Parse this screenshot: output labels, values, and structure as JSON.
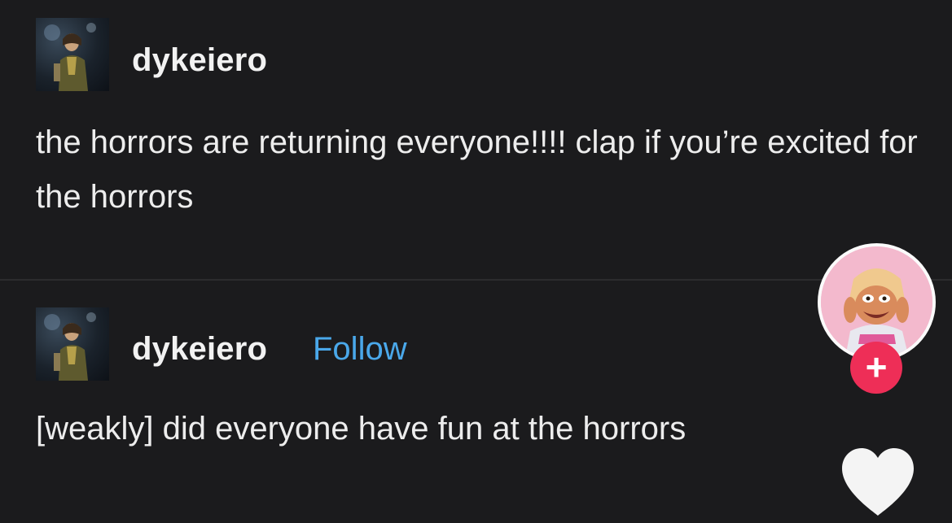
{
  "posts": [
    {
      "username": "dykeiero",
      "text": "the horrors are returning everyone!!!! clap if you’re excited for the horrors",
      "avatar_icon": "user-photo-avatar"
    },
    {
      "username": "dykeiero",
      "follow_label": "Follow",
      "text": "[weakly] did everyone have fun at the horrors",
      "avatar_icon": "user-photo-avatar"
    }
  ],
  "sidebar": {
    "creator_avatar_icon": "creator-profile-avatar",
    "follow_plus_label": "+",
    "like_icon": "heart-icon"
  },
  "colors": {
    "background": "#1b1b1d",
    "text": "#ededed",
    "link": "#4aa8ea",
    "follow_plus": "#ee2e57",
    "heart": "#f4f4f4"
  }
}
